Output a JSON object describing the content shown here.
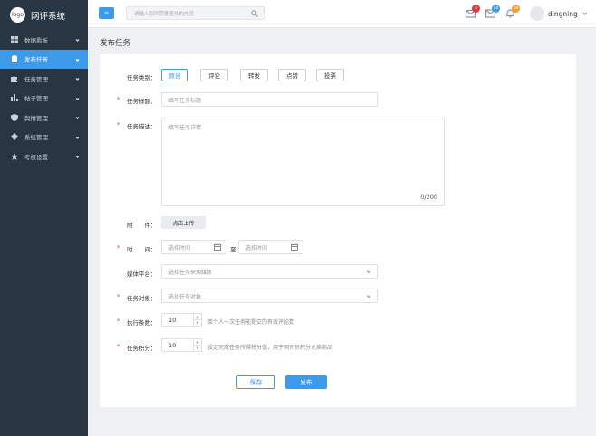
{
  "app": {
    "logo_text": "logo",
    "title": "网评系统"
  },
  "sidebar": {
    "items": [
      {
        "label": "数据看板",
        "icon": "dashboard-icon"
      },
      {
        "label": "发布任务",
        "icon": "clipboard-icon",
        "active": true
      },
      {
        "label": "任务管理",
        "icon": "puzzle-icon"
      },
      {
        "label": "帖子管理",
        "icon": "bar-chart-icon"
      },
      {
        "label": "舆情管理",
        "icon": "shield-icon"
      },
      {
        "label": "系统管理",
        "icon": "gear-icon"
      },
      {
        "label": "考核设置",
        "icon": "star-icon"
      }
    ]
  },
  "topbar": {
    "menu_label": "≡",
    "search_placeholder": "请输入您所需要查找的内容",
    "badges": [
      {
        "icon": "mail-icon",
        "count": "4",
        "color": "#e0393e"
      },
      {
        "icon": "message-icon",
        "count": "20",
        "color": "#3d9ae8"
      },
      {
        "icon": "bell-icon",
        "count": "16",
        "color": "#f39c33"
      }
    ],
    "username": "dingning"
  },
  "page": {
    "title": "发布任务"
  },
  "form": {
    "type_label": "任务类别：",
    "types": [
      "原创",
      "评论",
      "转发",
      "点赞",
      "投票"
    ],
    "selected_type": "原创",
    "title_label": "任务标题：",
    "title_placeholder": "填写任务标题",
    "desc_label": "任务描述：",
    "desc_placeholder": "填写任务详情",
    "desc_counter": "0/200",
    "attach_label": "附　　件：",
    "upload_label": "点击上传",
    "time_label": "时　　间：",
    "time_start_placeholder": "选择时间",
    "time_sep": "至",
    "time_end_placeholder": "选择时间",
    "platform_label": "媒体平台：",
    "platform_placeholder": "选择任务来源媒体",
    "target_label": "任务对象：",
    "target_placeholder": "选择任务对象",
    "count_label": "执行条数：",
    "count_value": "10",
    "count_hint": "单个人一次任务能提交的有效评论数",
    "points_label": "任务积分：",
    "points_value": "10",
    "points_hint": "设定完成任务所得积分值，用于网评员积分兑换商品",
    "save_label": "保存",
    "publish_label": "发布"
  }
}
